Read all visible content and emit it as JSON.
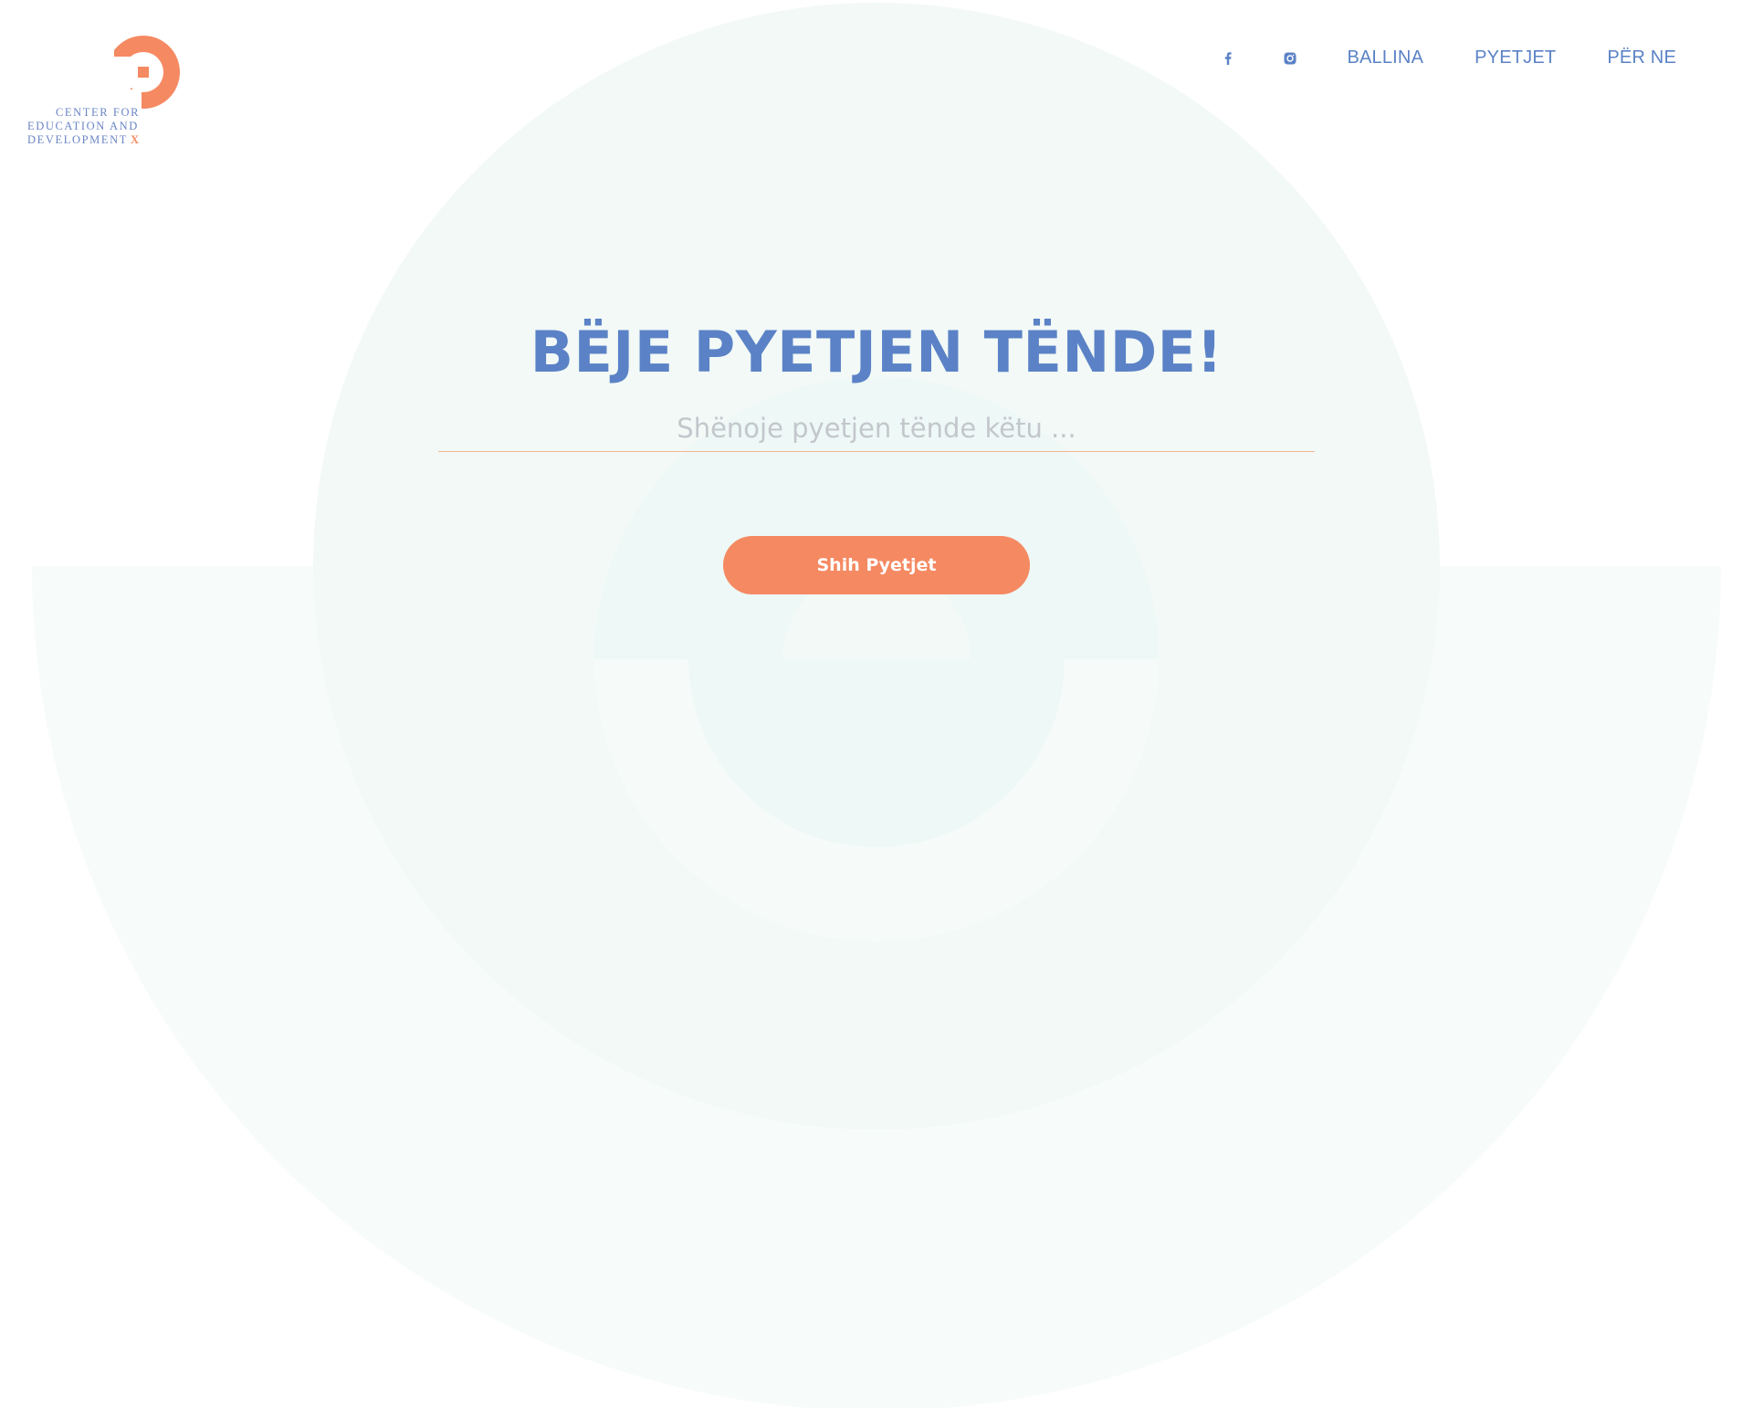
{
  "colors": {
    "brand_blue": "#5b82c6",
    "brand_orange": "#f58962",
    "placeholder_gray": "#c3c7cc",
    "bg_tint_outer": "#f7fbfa",
    "bg_tint_mid": "#f1f9f7",
    "bg_tint_inner": "#edf7f5"
  },
  "logo": {
    "line1": "CENTER FOR",
    "line2": "EDUCATION AND",
    "line3": "DEVELOPMENT",
    "mark": "X"
  },
  "nav": {
    "facebook_icon": "facebook-icon",
    "instagram_icon": "instagram-icon",
    "links": [
      "BALLINA",
      "PYETJET",
      "PËR NE"
    ]
  },
  "hero": {
    "title": "BËJE PYETJEN TËNDE!",
    "input_placeholder": "Shënoje pyetjen tënde këtu ...",
    "input_value": "",
    "button_label": "Shih Pyetjet"
  }
}
